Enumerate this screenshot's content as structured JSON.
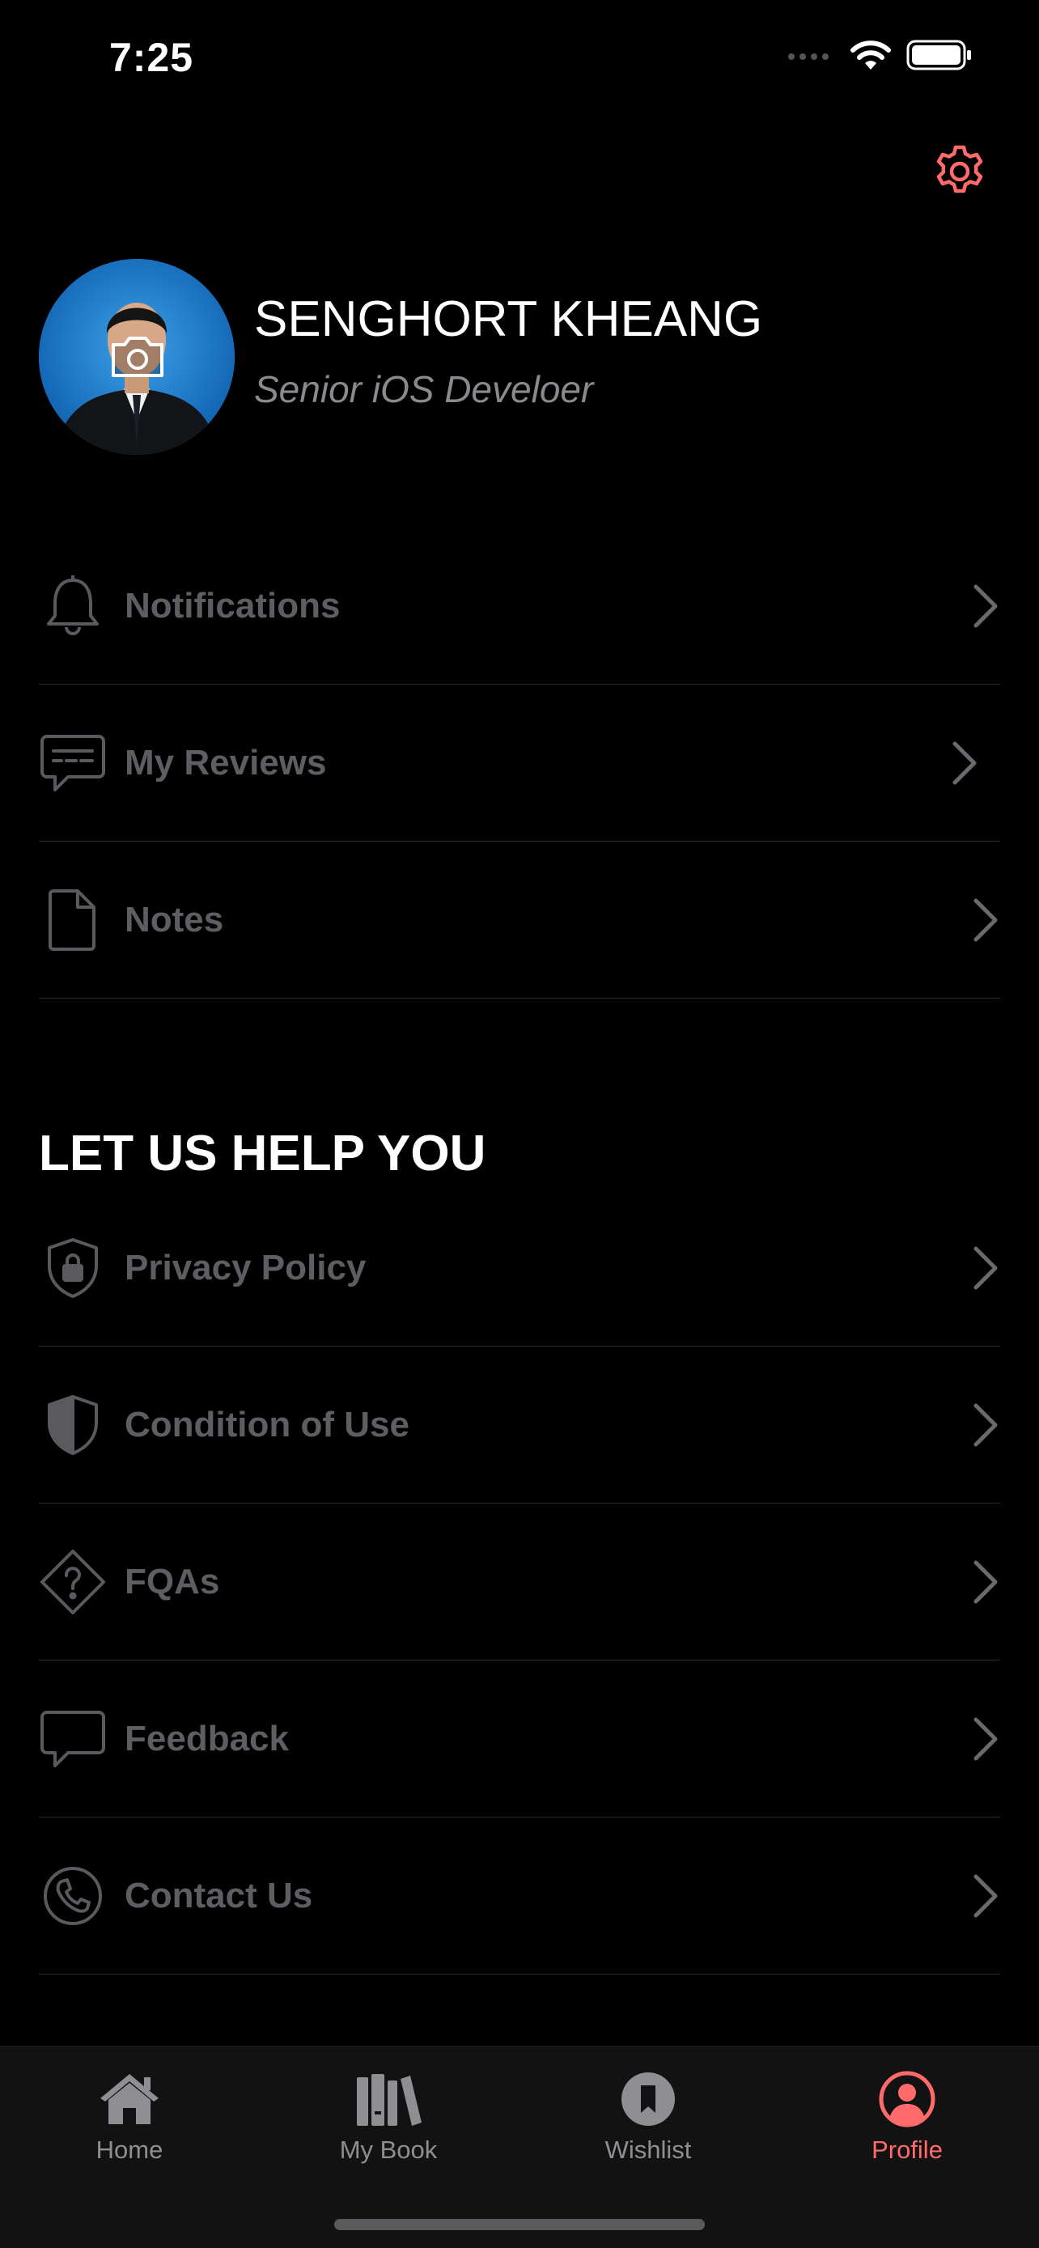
{
  "status_bar": {
    "time": "7:25"
  },
  "colors": {
    "accent": "#ff6b6b",
    "background": "#000000",
    "muted_text": "#5e5e62",
    "tab_bar": "#121212"
  },
  "profile": {
    "name": "SENGHORT KHEANG",
    "role": "Senior iOS Develoer"
  },
  "account_menu": [
    {
      "label": "Notifications",
      "icon": "bell-icon"
    },
    {
      "label": "My Reviews",
      "icon": "chat-lines-icon"
    },
    {
      "label": "Notes",
      "icon": "document-icon"
    }
  ],
  "help_section": {
    "title": "LET US HELP YOU",
    "items": [
      {
        "label": "Privacy Policy",
        "icon": "shield-lock-icon"
      },
      {
        "label": "Condition of Use",
        "icon": "shield-half-icon"
      },
      {
        "label": "FQAs",
        "icon": "question-diamond-icon"
      },
      {
        "label": "Feedback",
        "icon": "speech-bubble-icon"
      },
      {
        "label": "Contact Us",
        "icon": "phone-circle-icon"
      }
    ]
  },
  "tab_bar": {
    "tabs": [
      {
        "label": "Home",
        "icon": "house-icon",
        "active": false
      },
      {
        "label": "My Book",
        "icon": "books-icon",
        "active": false
      },
      {
        "label": "Wishlist",
        "icon": "bookmark-icon",
        "active": false
      },
      {
        "label": "Profile",
        "icon": "person-circle-icon",
        "active": true
      }
    ]
  }
}
